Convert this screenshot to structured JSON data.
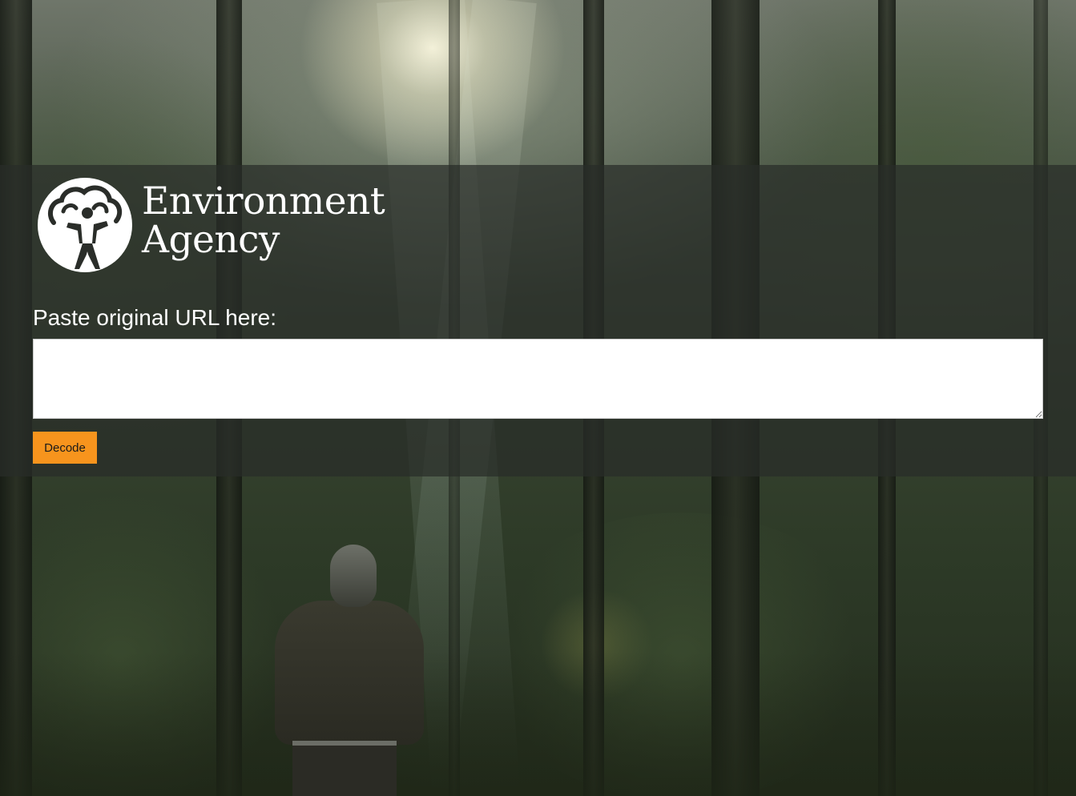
{
  "brand": {
    "name_line1": "Environment",
    "name_line2": "Agency",
    "logo_icon": "tree-person-icon",
    "text_color": "#ffffff"
  },
  "form": {
    "label": "Paste original URL here:",
    "input_value": "",
    "input_placeholder": "",
    "submit_label": "Decode"
  },
  "colors": {
    "accent": "#f7941d",
    "overlay": "rgba(40, 44, 40, 0.72)"
  },
  "background": {
    "description_icon": "forest-photo"
  }
}
